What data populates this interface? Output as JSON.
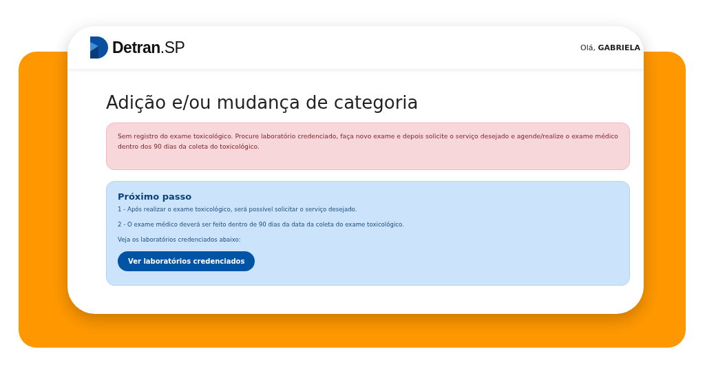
{
  "header": {
    "logo": "**Detran**.SP",
    "greeting": "Olá, **GABRIELA**"
  },
  "title": "Adição e/ou mudança de categoria",
  "alert": {
    "text": "Sem registro do exame toxicológico. Procure laboratório credenciado, faça novo exame e depois solicite o serviço desejado e agende/realize o exame médico dentro dos 90 dias da coleta do toxicológico."
  },
  "next_step": {
    "heading": "Próximo passo",
    "lines": [
      "1 - Após realizar o exame toxicológico, será possível solicitar o serviço desejado.",
      "2 - O exame médico deverá ser feito dentro de 90 dias da data da coleta do exame toxicológico.",
      "Veja os laboratórios credenciados abaixo:"
    ],
    "button": "Ver laboratórios credenciados"
  }
}
